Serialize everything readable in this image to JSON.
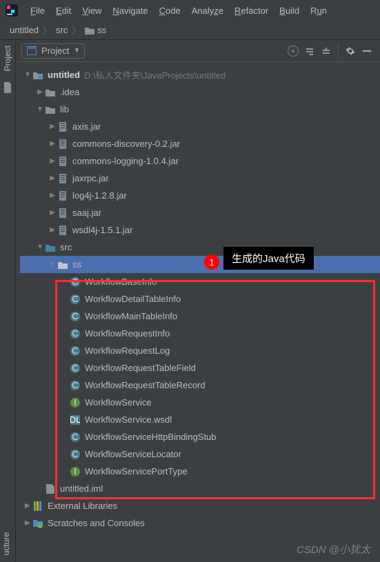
{
  "menu": {
    "file": "File",
    "edit": "Edit",
    "view": "View",
    "navigate": "Navigate",
    "code": "Code",
    "analyze": "Analyze",
    "refactor": "Refactor",
    "build": "Build",
    "run": "Run"
  },
  "breadcrumb": {
    "project": "untitled",
    "folder1": "src",
    "folder2": "ss"
  },
  "sidebar": {
    "project_label": "Project",
    "structure_label": "ucture"
  },
  "panel": {
    "title": "Project"
  },
  "annotation": {
    "num": "1",
    "text": "生成的Java代码"
  },
  "watermark": "CSDN @小犹太",
  "tree": {
    "root": {
      "name": "untitled",
      "path": "D:\\私人文件夹\\JavaProjects\\untitled"
    },
    "idea": ".idea",
    "lib": "lib",
    "jars": [
      "axis.jar",
      "commons-discovery-0.2.jar",
      "commons-logging-1.0.4.jar",
      "jaxrpc.jar",
      "log4j-1.2.8.jar",
      "saaj.jar",
      "wsdl4j-1.5.1.jar"
    ],
    "src": "src",
    "ss": "ss",
    "classes": [
      {
        "name": "WorkflowBaseInfo",
        "kind": "class"
      },
      {
        "name": "WorkflowDetailTableInfo",
        "kind": "class"
      },
      {
        "name": "WorkflowMainTableInfo",
        "kind": "class"
      },
      {
        "name": "WorkflowRequestInfo",
        "kind": "class"
      },
      {
        "name": "WorkflowRequestLog",
        "kind": "class"
      },
      {
        "name": "WorkflowRequestTableField",
        "kind": "class"
      },
      {
        "name": "WorkflowRequestTableRecord",
        "kind": "class"
      },
      {
        "name": "WorkflowService",
        "kind": "interface"
      },
      {
        "name": "WorkflowService.wsdl",
        "kind": "wsdl"
      },
      {
        "name": "WorkflowServiceHttpBindingStub",
        "kind": "class"
      },
      {
        "name": "WorkflowServiceLocator",
        "kind": "class"
      },
      {
        "name": "WorkflowServicePortType",
        "kind": "interface"
      }
    ],
    "iml": "untitled.iml",
    "ext": "External Libraries",
    "scratch": "Scratches and Consoles"
  }
}
